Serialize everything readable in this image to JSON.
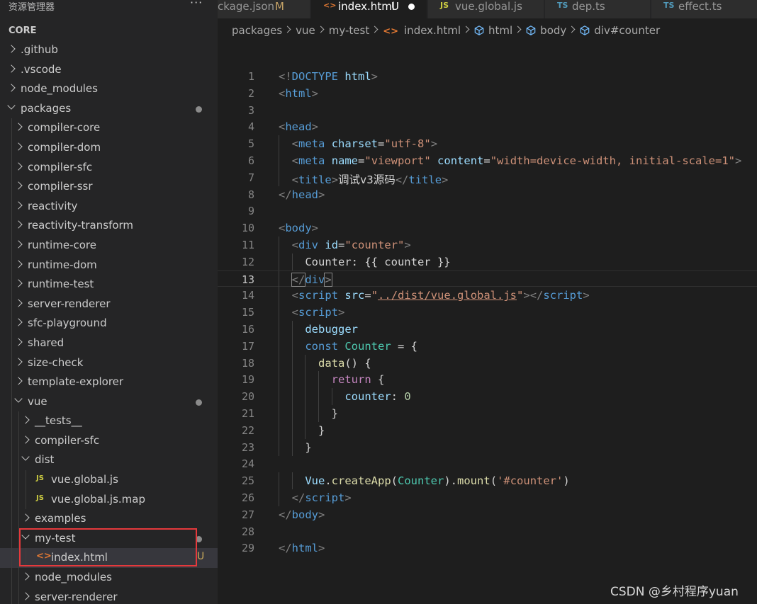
{
  "sidebar": {
    "title": "资源管理器",
    "more": "···",
    "section": "CORE",
    "items": [
      {
        "label": ".github",
        "depth": 0,
        "kind": "folder-closed"
      },
      {
        "label": ".vscode",
        "depth": 0,
        "kind": "folder-closed"
      },
      {
        "label": "node_modules",
        "depth": 0,
        "kind": "folder-closed"
      },
      {
        "label": "packages",
        "depth": 0,
        "kind": "folder-open",
        "dot": true
      },
      {
        "label": "compiler-core",
        "depth": 1,
        "kind": "folder-closed"
      },
      {
        "label": "compiler-dom",
        "depth": 1,
        "kind": "folder-closed"
      },
      {
        "label": "compiler-sfc",
        "depth": 1,
        "kind": "folder-closed"
      },
      {
        "label": "compiler-ssr",
        "depth": 1,
        "kind": "folder-closed"
      },
      {
        "label": "reactivity",
        "depth": 1,
        "kind": "folder-closed"
      },
      {
        "label": "reactivity-transform",
        "depth": 1,
        "kind": "folder-closed"
      },
      {
        "label": "runtime-core",
        "depth": 1,
        "kind": "folder-closed"
      },
      {
        "label": "runtime-dom",
        "depth": 1,
        "kind": "folder-closed"
      },
      {
        "label": "runtime-test",
        "depth": 1,
        "kind": "folder-closed"
      },
      {
        "label": "server-renderer",
        "depth": 1,
        "kind": "folder-closed"
      },
      {
        "label": "sfc-playground",
        "depth": 1,
        "kind": "folder-closed"
      },
      {
        "label": "shared",
        "depth": 1,
        "kind": "folder-closed"
      },
      {
        "label": "size-check",
        "depth": 1,
        "kind": "folder-closed"
      },
      {
        "label": "template-explorer",
        "depth": 1,
        "kind": "folder-closed"
      },
      {
        "label": "vue",
        "depth": 1,
        "kind": "folder-open",
        "dot": true
      },
      {
        "label": "__tests__",
        "depth": 2,
        "kind": "folder-closed"
      },
      {
        "label": "compiler-sfc",
        "depth": 2,
        "kind": "folder-closed"
      },
      {
        "label": "dist",
        "depth": 2,
        "kind": "folder-open"
      },
      {
        "label": "vue.global.js",
        "depth": 3,
        "kind": "file-js"
      },
      {
        "label": "vue.global.js.map",
        "depth": 3,
        "kind": "file-js"
      },
      {
        "label": "examples",
        "depth": 2,
        "kind": "folder-closed"
      },
      {
        "label": "my-test",
        "depth": 2,
        "kind": "folder-open",
        "dot": true
      },
      {
        "label": "index.html",
        "depth": 3,
        "kind": "file-html",
        "badge": "U",
        "selected": true
      },
      {
        "label": "node_modules",
        "depth": 2,
        "kind": "folder-closed"
      },
      {
        "label": "server-renderer",
        "depth": 2,
        "kind": "folder-closed"
      }
    ],
    "js_icon": "JS",
    "html_icon": "<>"
  },
  "tabs": [
    {
      "label": "ckage.json",
      "status": "M",
      "icon": "",
      "active": false
    },
    {
      "label": "index.html",
      "status": "U",
      "icon": "<>",
      "active": true,
      "dirty": true
    },
    {
      "label": "vue.global.js",
      "status": "",
      "icon": "JS",
      "active": false
    },
    {
      "label": "dep.ts",
      "status": "",
      "icon": "TS",
      "active": false
    },
    {
      "label": "effect.ts",
      "status": "",
      "icon": "TS",
      "active": false
    }
  ],
  "breadcrumb": {
    "items": [
      "packages",
      "vue",
      "my-test",
      "index.html",
      "html",
      "body",
      "div#counter"
    ],
    "html_icon": "<>"
  },
  "editor": {
    "current_line": 13,
    "lines": [
      {
        "n": "1",
        "tokens": [
          [
            "br",
            "<!"
          ],
          [
            "tag",
            "DOCTYPE"
          ],
          [
            "text",
            " "
          ],
          [
            "attr",
            "html"
          ],
          [
            "br",
            ">"
          ]
        ]
      },
      {
        "n": "2",
        "tokens": [
          [
            "br",
            "<"
          ],
          [
            "tag",
            "html"
          ],
          [
            "br",
            ">"
          ]
        ]
      },
      {
        "n": "3",
        "tokens": []
      },
      {
        "n": "4",
        "tokens": [
          [
            "br",
            "<"
          ],
          [
            "tag",
            "head"
          ],
          [
            "br",
            ">"
          ]
        ]
      },
      {
        "n": "5",
        "tokens": [
          [
            "text",
            "  "
          ],
          [
            "br",
            "<"
          ],
          [
            "tag",
            "meta"
          ],
          [
            "text",
            " "
          ],
          [
            "attr",
            "charset"
          ],
          [
            "text",
            "="
          ],
          [
            "str",
            "\"utf-8\""
          ],
          [
            "br",
            ">"
          ]
        ]
      },
      {
        "n": "6",
        "tokens": [
          [
            "text",
            "  "
          ],
          [
            "br",
            "<"
          ],
          [
            "tag",
            "meta"
          ],
          [
            "text",
            " "
          ],
          [
            "attr",
            "name"
          ],
          [
            "text",
            "="
          ],
          [
            "str",
            "\"viewport\""
          ],
          [
            "text",
            " "
          ],
          [
            "attr",
            "content"
          ],
          [
            "text",
            "="
          ],
          [
            "str",
            "\"width=device-width, initial-scale=1\""
          ],
          [
            "br",
            ">"
          ]
        ]
      },
      {
        "n": "7",
        "tokens": [
          [
            "text",
            "  "
          ],
          [
            "br",
            "<"
          ],
          [
            "tag",
            "title"
          ],
          [
            "br",
            ">"
          ],
          [
            "text",
            "调试v3源码"
          ],
          [
            "br",
            "</"
          ],
          [
            "tag",
            "title"
          ],
          [
            "br",
            ">"
          ]
        ]
      },
      {
        "n": "8",
        "tokens": [
          [
            "br",
            "</"
          ],
          [
            "tag",
            "head"
          ],
          [
            "br",
            ">"
          ]
        ]
      },
      {
        "n": "9",
        "tokens": []
      },
      {
        "n": "10",
        "tokens": [
          [
            "br",
            "<"
          ],
          [
            "tag",
            "body"
          ],
          [
            "br",
            ">"
          ]
        ]
      },
      {
        "n": "11",
        "tokens": [
          [
            "text",
            "  "
          ],
          [
            "br",
            "<"
          ],
          [
            "tag",
            "div"
          ],
          [
            "text",
            " "
          ],
          [
            "attr",
            "id"
          ],
          [
            "text",
            "="
          ],
          [
            "str",
            "\"counter\""
          ],
          [
            "br",
            ">"
          ]
        ]
      },
      {
        "n": "12",
        "tokens": [
          [
            "text",
            "    Counter: {{ counter }}"
          ]
        ]
      },
      {
        "n": "13",
        "tokens": [
          [
            "text",
            "  "
          ],
          [
            "brbox",
            "</"
          ],
          [
            "tag",
            "div"
          ],
          [
            "brbox",
            ">"
          ]
        ]
      },
      {
        "n": "14",
        "tokens": [
          [
            "text",
            "  "
          ],
          [
            "br",
            "<"
          ],
          [
            "tag",
            "script"
          ],
          [
            "text",
            " "
          ],
          [
            "attr",
            "src"
          ],
          [
            "text",
            "="
          ],
          [
            "str",
            "\""
          ],
          [
            "link",
            "../dist/vue.global.js"
          ],
          [
            "str",
            "\""
          ],
          [
            "br",
            "></"
          ],
          [
            "tag",
            "script"
          ],
          [
            "br",
            ">"
          ]
        ]
      },
      {
        "n": "15",
        "tokens": [
          [
            "text",
            "  "
          ],
          [
            "br",
            "<"
          ],
          [
            "tag",
            "script"
          ],
          [
            "br",
            ">"
          ]
        ]
      },
      {
        "n": "16",
        "tokens": [
          [
            "text",
            "    "
          ],
          [
            "var",
            "debugger"
          ]
        ]
      },
      {
        "n": "17",
        "tokens": [
          [
            "text",
            "    "
          ],
          [
            "kw",
            "const"
          ],
          [
            "text",
            " "
          ],
          [
            "class",
            "Counter"
          ],
          [
            "text",
            " = {"
          ]
        ]
      },
      {
        "n": "18",
        "tokens": [
          [
            "text",
            "      "
          ],
          [
            "fn",
            "data"
          ],
          [
            "text",
            "() {"
          ]
        ]
      },
      {
        "n": "19",
        "tokens": [
          [
            "text",
            "        "
          ],
          [
            "ctrl",
            "return"
          ],
          [
            "text",
            " {"
          ]
        ]
      },
      {
        "n": "20",
        "tokens": [
          [
            "text",
            "          "
          ],
          [
            "var",
            "counter"
          ],
          [
            "text",
            ": "
          ],
          [
            "num",
            "0"
          ]
        ]
      },
      {
        "n": "21",
        "tokens": [
          [
            "text",
            "        }"
          ]
        ]
      },
      {
        "n": "22",
        "tokens": [
          [
            "text",
            "      }"
          ]
        ]
      },
      {
        "n": "23",
        "tokens": [
          [
            "text",
            "    }"
          ]
        ]
      },
      {
        "n": "24",
        "tokens": []
      },
      {
        "n": "25",
        "tokens": [
          [
            "text",
            "    "
          ],
          [
            "var",
            "Vue"
          ],
          [
            "text",
            "."
          ],
          [
            "fn",
            "createApp"
          ],
          [
            "text",
            "("
          ],
          [
            "class",
            "Counter"
          ],
          [
            "text",
            ")."
          ],
          [
            "fn",
            "mount"
          ],
          [
            "text",
            "("
          ],
          [
            "str",
            "'#counter'"
          ],
          [
            "text",
            ")"
          ]
        ]
      },
      {
        "n": "26",
        "tokens": [
          [
            "text",
            "  "
          ],
          [
            "br",
            "</"
          ],
          [
            "tag",
            "script"
          ],
          [
            "br",
            ">"
          ]
        ]
      },
      {
        "n": "27",
        "tokens": [
          [
            "br",
            "</"
          ],
          [
            "tag",
            "body"
          ],
          [
            "br",
            ">"
          ]
        ]
      },
      {
        "n": "28",
        "tokens": []
      },
      {
        "n": "29",
        "tokens": [
          [
            "br",
            "</"
          ],
          [
            "tag",
            "html"
          ],
          [
            "br",
            ">"
          ]
        ]
      }
    ]
  },
  "watermark": "CSDN @乡村程序yuan"
}
